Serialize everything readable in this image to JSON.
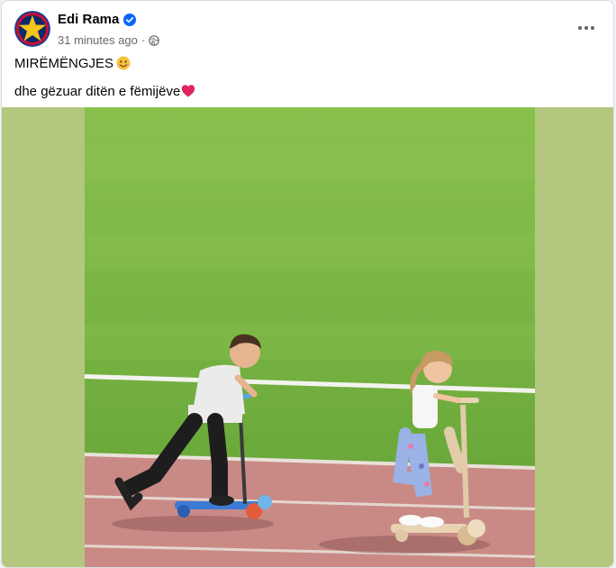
{
  "post": {
    "author": "Edi Rama",
    "timestamp": "31 minutes ago",
    "separator": "·",
    "line1": "MIRËMËNGJES",
    "line2": "dhe gëzuar ditën e fëmijëve",
    "audience_icon": "globe-icon",
    "verified_icon": "verified-badge-icon",
    "menu_icon": "more-options-icon"
  },
  "colors": {
    "accent": "#0866ff",
    "media_backdrop": "#b4c77f",
    "grass": "#7db845",
    "track": "#c98a86"
  }
}
